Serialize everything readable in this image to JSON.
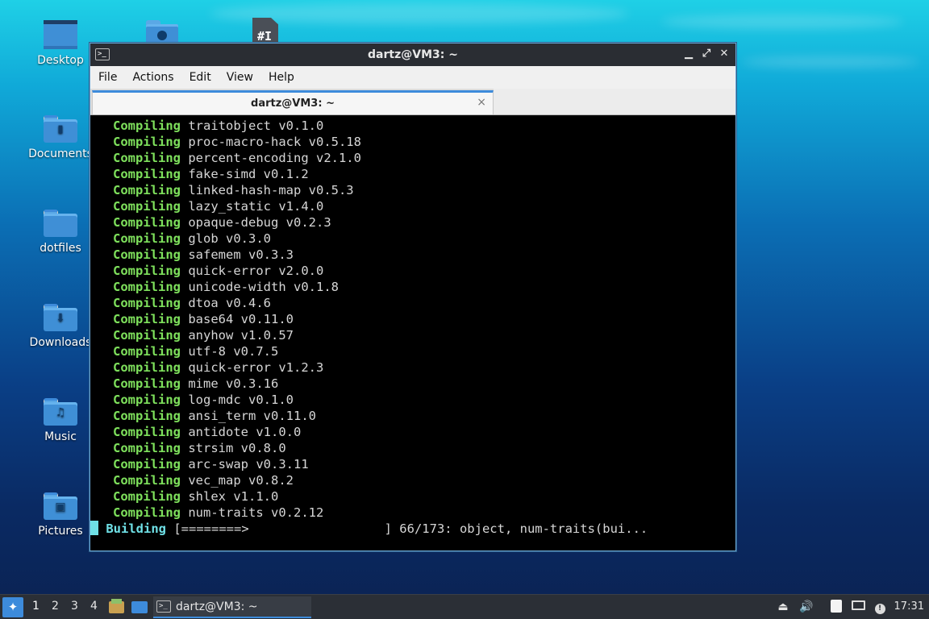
{
  "desktop": {
    "icons": [
      {
        "label": "Desktop"
      },
      {
        "label": "Documents"
      },
      {
        "label": "dotfiles"
      },
      {
        "label": "Downloads"
      },
      {
        "label": "Music"
      },
      {
        "label": "Pictures"
      }
    ]
  },
  "window": {
    "title": "dartz@VM3: ~",
    "app_icon": ">_",
    "controls": {
      "minimize": "▁",
      "maximize": "⤢",
      "close": "✕"
    },
    "menu": [
      "File",
      "Actions",
      "Edit",
      "View",
      "Help"
    ],
    "tab": {
      "label": "dartz@VM3: ~",
      "close": "×"
    }
  },
  "terminal": {
    "lines": [
      {
        "kw": "Compiling",
        "text": "traitobject v0.1.0"
      },
      {
        "kw": "Compiling",
        "text": "proc-macro-hack v0.5.18"
      },
      {
        "kw": "Compiling",
        "text": "percent-encoding v2.1.0"
      },
      {
        "kw": "Compiling",
        "text": "fake-simd v0.1.2"
      },
      {
        "kw": "Compiling",
        "text": "linked-hash-map v0.5.3"
      },
      {
        "kw": "Compiling",
        "text": "lazy_static v1.4.0"
      },
      {
        "kw": "Compiling",
        "text": "opaque-debug v0.2.3"
      },
      {
        "kw": "Compiling",
        "text": "glob v0.3.0"
      },
      {
        "kw": "Compiling",
        "text": "safemem v0.3.3"
      },
      {
        "kw": "Compiling",
        "text": "quick-error v2.0.0"
      },
      {
        "kw": "Compiling",
        "text": "unicode-width v0.1.8"
      },
      {
        "kw": "Compiling",
        "text": "dtoa v0.4.6"
      },
      {
        "kw": "Compiling",
        "text": "base64 v0.11.0"
      },
      {
        "kw": "Compiling",
        "text": "anyhow v1.0.57"
      },
      {
        "kw": "Compiling",
        "text": "utf-8 v0.7.5"
      },
      {
        "kw": "Compiling",
        "text": "quick-error v1.2.3"
      },
      {
        "kw": "Compiling",
        "text": "mime v0.3.16"
      },
      {
        "kw": "Compiling",
        "text": "log-mdc v0.1.0"
      },
      {
        "kw": "Compiling",
        "text": "ansi_term v0.11.0"
      },
      {
        "kw": "Compiling",
        "text": "antidote v1.0.0"
      },
      {
        "kw": "Compiling",
        "text": "strsim v0.8.0"
      },
      {
        "kw": "Compiling",
        "text": "arc-swap v0.3.11"
      },
      {
        "kw": "Compiling",
        "text": "vec_map v0.8.2"
      },
      {
        "kw": "Compiling",
        "text": "shlex v1.1.0"
      },
      {
        "kw": "Compiling",
        "text": "num-traits v0.2.12"
      }
    ],
    "build_line": {
      "kw": "Building",
      "text": "[========>                  ] 66/173: object, num-traits(bui..."
    }
  },
  "taskbar": {
    "workspaces": [
      "1",
      "2",
      "3",
      "4"
    ],
    "task": {
      "label": "dartz@VM3: ~",
      "icon": ">_"
    },
    "tray_icons": [
      "eject-icon",
      "volume-icon",
      "clipboard-icon",
      "network-icon",
      "update-icon"
    ],
    "clock": "17:31"
  }
}
